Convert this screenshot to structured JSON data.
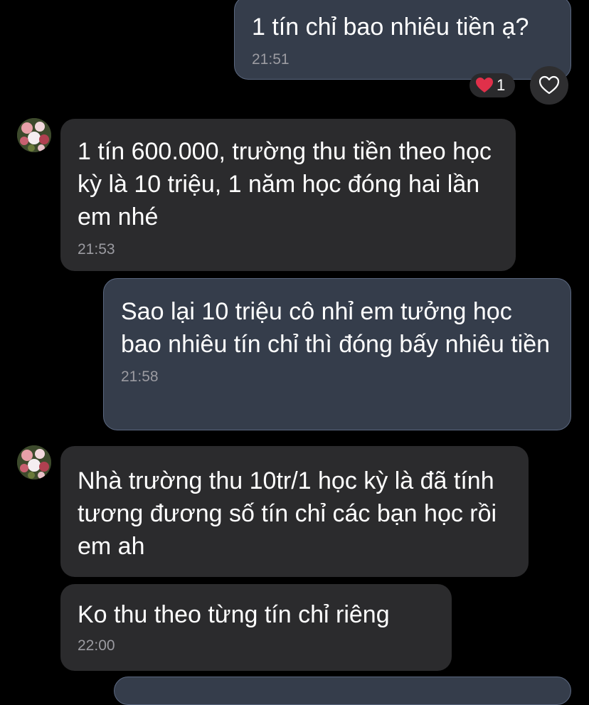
{
  "messages": [
    {
      "direction": "outgoing",
      "text": "1 tín chỉ bao nhiêu tiền ạ?",
      "time": "21:51",
      "reaction": {
        "emoji": "heart-icon",
        "count": "1"
      }
    },
    {
      "direction": "incoming",
      "text": "1 tín 600.000, trường thu tiền theo học kỳ là 10 triệu, 1 năm học đóng hai lần em nhé",
      "time": "21:53"
    },
    {
      "direction": "outgoing",
      "text": "Sao lại 10 triệu cô nhỉ em tưởng học bao nhiêu tín chỉ thì đóng bấy nhiêu tiền",
      "time": "21:58"
    },
    {
      "direction": "incoming",
      "text": "Nhà trường thu 10tr/1 học kỳ là đã tính tương đương số tín chỉ các bạn học rồi em ah",
      "time": ""
    },
    {
      "direction": "incoming",
      "text": "Ko thu theo từng tín chỉ riêng",
      "time": "22:00"
    }
  ],
  "colors": {
    "background": "#000000",
    "outgoing_bubble": "#353d4b",
    "incoming_bubble": "#2b2b2d",
    "heart": "#e0304a",
    "time_text": "#9b9ba1"
  }
}
